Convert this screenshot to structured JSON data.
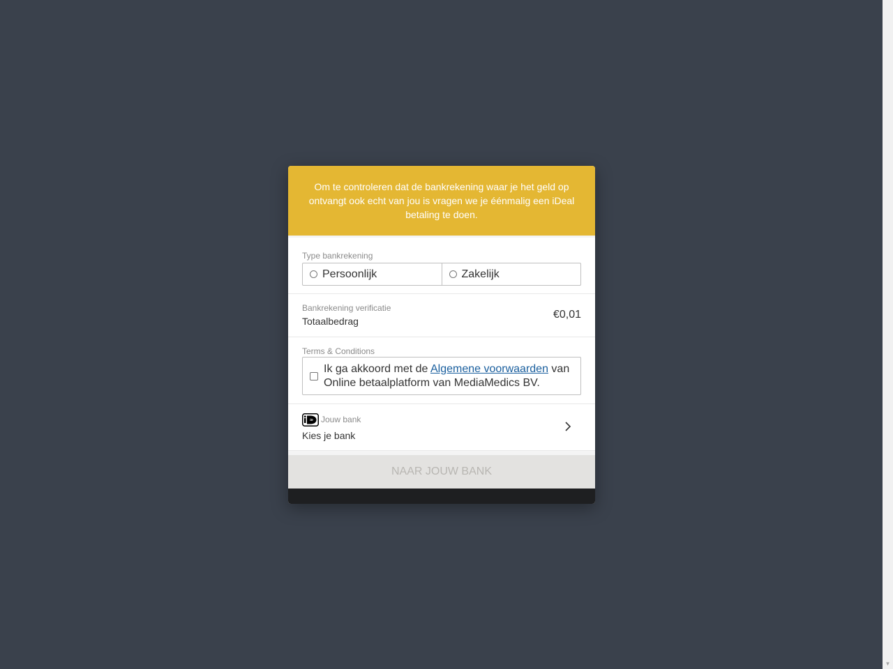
{
  "banner": {
    "text": "Om te controleren dat de bankrekening waar je het geld op ontvangt ook echt van jou is vragen we je éénmalig een iDeal betaling te doen."
  },
  "account_type": {
    "label": "Type bankrekening",
    "options": [
      "Persoonlijk",
      "Zakelijk"
    ]
  },
  "amount": {
    "small_label": "Bankrekening verificatie",
    "label": "Totaalbedrag",
    "value": "€0,01"
  },
  "terms": {
    "label": "Terms & Conditions",
    "text_before": "Ik ga akkoord met de ",
    "link_text": "Algemene voorwaarden",
    "text_after": " van Online betaalplatform van MediaMedics BV."
  },
  "bank": {
    "small_label": "Jouw bank",
    "value": "Kies je bank",
    "icon": "ideal-icon"
  },
  "submit": {
    "label": "NAAR JOUW BANK"
  },
  "colors": {
    "background": "#3a414c",
    "banner": "#e4b733",
    "link": "#1a5f9e",
    "button_disabled": "#e3e2e0"
  }
}
